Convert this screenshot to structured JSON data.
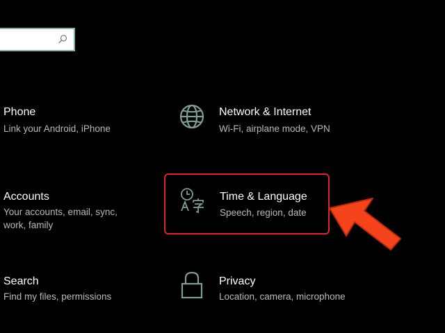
{
  "search": {
    "value": "",
    "placeholder": ""
  },
  "tiles": {
    "phone": {
      "title": "Phone",
      "description": "Link your Android, iPhone"
    },
    "network": {
      "title": "Network & Internet",
      "description": "Wi-Fi, airplane mode, VPN",
      "icon": "globe-icon"
    },
    "accounts": {
      "title": "Accounts",
      "description": "Your accounts, email, sync, work, family"
    },
    "time_language": {
      "title": "Time & Language",
      "description": "Speech, region, date",
      "icon": "time-language-icon",
      "highlighted": true
    },
    "search": {
      "title": "Search",
      "description": "Find my files, permissions"
    },
    "privacy": {
      "title": "Privacy",
      "description": "Location, camera, microphone",
      "icon": "lock-icon"
    }
  },
  "annotation": {
    "arrow": "red-arrow-icon",
    "highlight_color": "#e0242a",
    "arrow_color": "#f5441b"
  },
  "colors": {
    "background": "#000000",
    "title": "#ffffff",
    "description": "#b9b9b9",
    "icon": "#7f9f92",
    "search_border": "#7fb5a0"
  }
}
